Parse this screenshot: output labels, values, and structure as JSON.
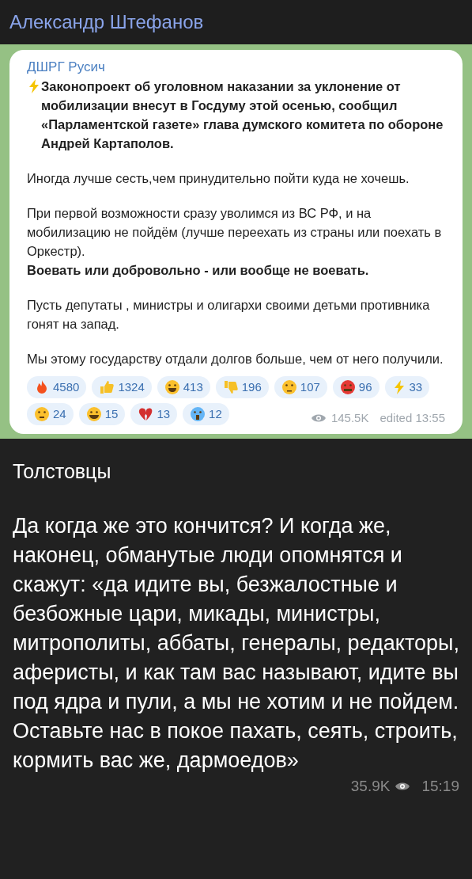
{
  "header": {
    "title": "Александр Штефанов"
  },
  "forwarded_post": {
    "channel": "ДШРГ Русич",
    "blocks": [
      [
        {
          "text": "Законопроект об уголовном наказании за уклонение от мобилизации внесут в Госдуму этой осенью, сообщил «Парламентской газете» глава думского комитета по обороне Андрей Картаполов.",
          "bold": true,
          "kind": "lightning-lead"
        }
      ],
      [
        {
          "text": "Иногда лучше сесть,чем принудительно пойти куда не хочешь.",
          "bold": false
        }
      ],
      [
        {
          "text": "При первой возможности сразу уволимся из ВС РФ, и на мобилизацию не пойдём (лучше переехать из страны или поехать в Оркестр).",
          "bold": false
        },
        {
          "text": "Воевать или добровольно - или вообще не воевать.",
          "bold": true
        }
      ],
      [
        {
          "text": "Пусть депутаты , министры и олигархи своими детьми противника гонят на запад.",
          "bold": false
        }
      ],
      [
        {
          "text": "Мы этому государству отдали долгов больше, чем от него получили.",
          "bold": false
        }
      ]
    ],
    "reactions": [
      {
        "kind": "fire",
        "count": "4580"
      },
      {
        "kind": "thumbs-up",
        "count": "1324"
      },
      {
        "kind": "laughing",
        "count": "413"
      },
      {
        "kind": "thumbs-down",
        "count": "196"
      },
      {
        "kind": "thinking",
        "count": "107"
      },
      {
        "kind": "angry",
        "count": "96"
      },
      {
        "kind": "lightning",
        "count": "33"
      },
      {
        "kind": "exploding",
        "count": "24"
      },
      {
        "kind": "grinning",
        "count": "15"
      },
      {
        "kind": "broken-heart",
        "count": "13"
      },
      {
        "kind": "screaming",
        "count": "12"
      }
    ],
    "views": "145.5K",
    "edited": "edited 13:55"
  },
  "message": {
    "author": "Толстовцы",
    "text": "Да когда же это кончится? И когда же, наконец, обманутые люди опомнятся и скажут: «да идите вы, безжалостные и безбожные цари, микады, министры, митрополиты, аббаты, генералы, редакторы, аферисты, и как там вас называют, идите вы под ядра и пули, а мы не хотим и не пойдем. Оставьте нас в покое пахать, сеять, строить, кормить вас же, дармоедов»",
    "views": "35.9K",
    "time": "15:19"
  }
}
